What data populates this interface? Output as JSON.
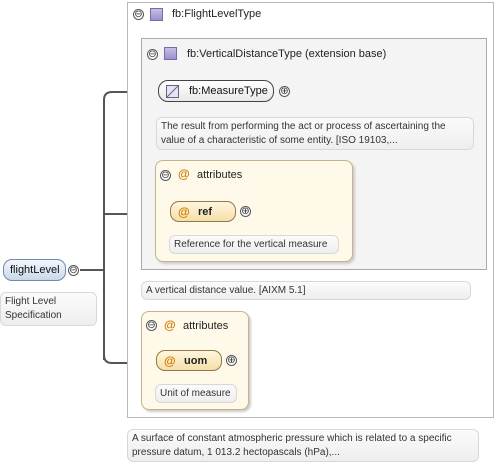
{
  "root_element": {
    "label": "flightLevel",
    "doc": "Flight Level Specification"
  },
  "flight_level_type": {
    "header": "fb:FlightLevelType",
    "doc": "A surface of constant atmospheric pressure which is related to a specific pressure datum, 1 013.2 hectopascals (hPa),..."
  },
  "vertical_distance_type": {
    "header": "fb:VerticalDistanceType (extension base)",
    "doc": "A vertical distance value. [AIXM 5.1]"
  },
  "measure_type": {
    "label": "fb:MeasureType",
    "doc": "The result from performing the act or process of ascertaining the value of a characteristic of some entity. [ISO 19103,..."
  },
  "attributes_inner": {
    "header": "attributes",
    "attr_name": "ref",
    "attr_doc": "Reference for the vertical measure"
  },
  "attributes_outer": {
    "header": "attributes",
    "attr_name": "uom",
    "attr_doc": "Unit of measure"
  },
  "symbols": {
    "collapse": "⊖",
    "expand": "⊕",
    "attribute_marker": "@"
  }
}
